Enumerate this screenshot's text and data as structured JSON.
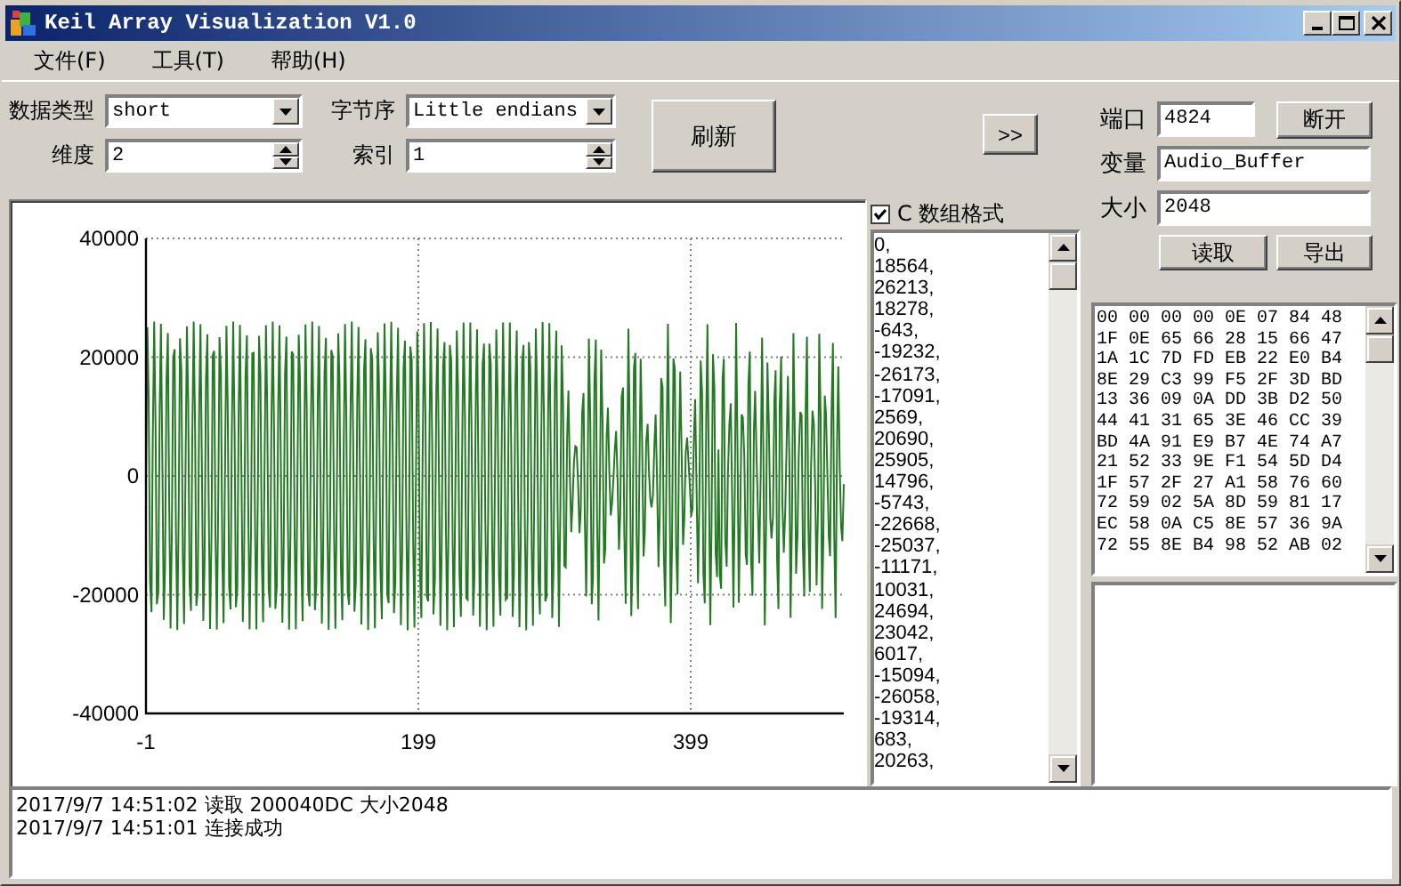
{
  "window": {
    "title": "Keil Array Visualization V1.0"
  },
  "menu": [
    "文件(F)",
    "工具(T)",
    "帮助(H)"
  ],
  "settings": [
    {
      "kind": "combo",
      "label": "数据类型",
      "value": "short"
    },
    {
      "kind": "combo",
      "label": "字节序",
      "value": "Little endians"
    },
    {
      "kind": "spin",
      "label": "维度",
      "value": "2"
    },
    {
      "kind": "spin",
      "label": "索引",
      "value": "1"
    }
  ],
  "refresh_button": "刷新",
  "expand_button": ">>",
  "connection": {
    "port": {
      "label": "端口",
      "value": "4824"
    },
    "disconnect_button": "断开",
    "variable": {
      "label": "变量",
      "value": "Audio_Buffer"
    },
    "size": {
      "label": "大小",
      "value": "2048"
    },
    "read_button": "读取",
    "export_button": "导出"
  },
  "plot": {
    "y_ticks": [
      "40000",
      "20000",
      "0",
      "-20000",
      "-40000"
    ],
    "x_ticks": [
      "-1",
      "199",
      "399"
    ]
  },
  "c_array": {
    "label": "C 数组格式",
    "checked": true,
    "values": [
      "0,",
      "18564,",
      "26213,",
      "18278,",
      "-643,",
      "-19232,",
      "-26173,",
      "-17091,",
      "2569,",
      "20690,",
      "25905,",
      "14796,",
      "-5743,",
      "-22668,",
      "-25037,",
      "-11171,",
      "10031,",
      "24694,",
      "23042,",
      "6017,",
      "-15094,",
      "-26058,",
      "-19314,",
      "683,",
      "20263,"
    ]
  },
  "hex_dump": [
    "00 00 00 00 0E 07 84 48",
    "1F 0E 65 66 28 15 66 47",
    "1A 1C 7D FD EB 22 E0 B4",
    "8E 29 C3 99 F5 2F 3D BD",
    "13 36 09 0A DD 3B D2 50",
    "44 41 31 65 3E 46 CC 39",
    "BD 4A 91 E9 B7 4E 74 A7",
    "21 52 33 9E F1 54 5D D4",
    "1F 57 2F 27 A1 58 76 60",
    "72 59 02 5A 8D 59 81 17",
    "EC 58 0A C5 8E 57 36 9A",
    "72 55 8E B4 98 52 AB 02"
  ],
  "log": [
    "2017/9/7 14:51:02 读取 200040DC 大小2048",
    "2017/9/7 14:51:01 连接成功"
  ]
}
